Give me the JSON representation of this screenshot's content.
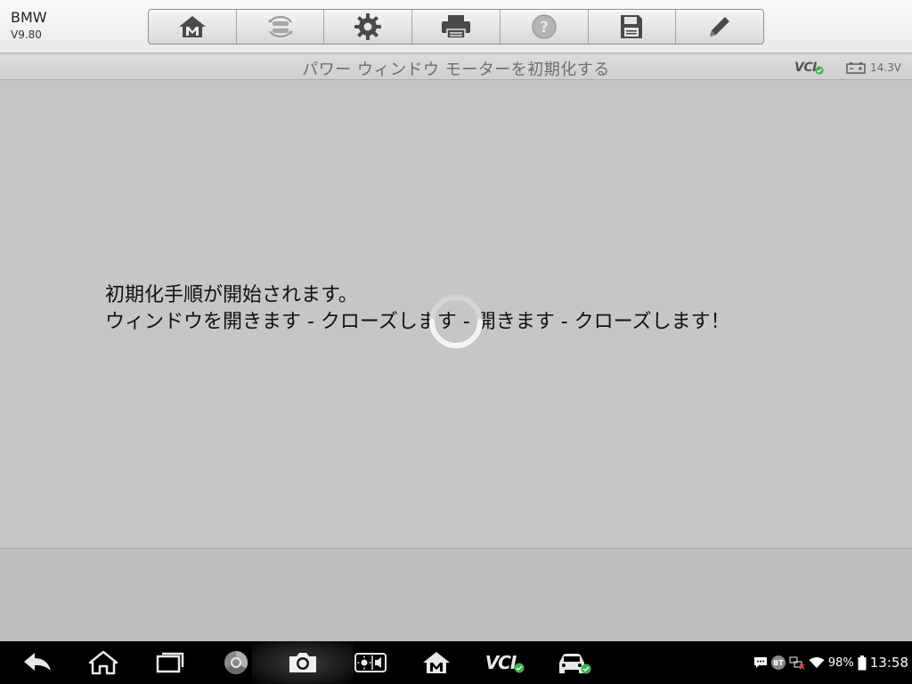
{
  "app": {
    "brand": "BMW",
    "version": "V9.80"
  },
  "toolbar": {
    "buttons": [
      {
        "name": "home-button",
        "icon": "home-m-icon"
      },
      {
        "name": "vehicle-swap-button",
        "icon": "vehicle-swap-icon"
      },
      {
        "name": "settings-button",
        "icon": "gear-icon"
      },
      {
        "name": "print-button",
        "icon": "printer-icon"
      },
      {
        "name": "help-button",
        "icon": "help-icon"
      },
      {
        "name": "save-button",
        "icon": "floppy-disk-icon"
      },
      {
        "name": "edit-button",
        "icon": "pencil-icon"
      }
    ]
  },
  "titlebar": {
    "title": "パワー ウィンドウ モーターを初期化する",
    "vcl_label": "VCI",
    "battery_voltage": "14.3V"
  },
  "main": {
    "message_line1": "初期化手順が開始されます。",
    "message_line2": "ウィンドウを開きます - クローズします - 開きます - クローズします！"
  },
  "navbar": {
    "vcl_label": "VCI",
    "bt_label": "BT",
    "battery_percent": "98%",
    "clock": "13:58"
  },
  "colors": {
    "background": "#c5c6c7",
    "toolbar": "#e9e9ea",
    "accent_green": "#3cb34a",
    "navbar": "#000000"
  }
}
